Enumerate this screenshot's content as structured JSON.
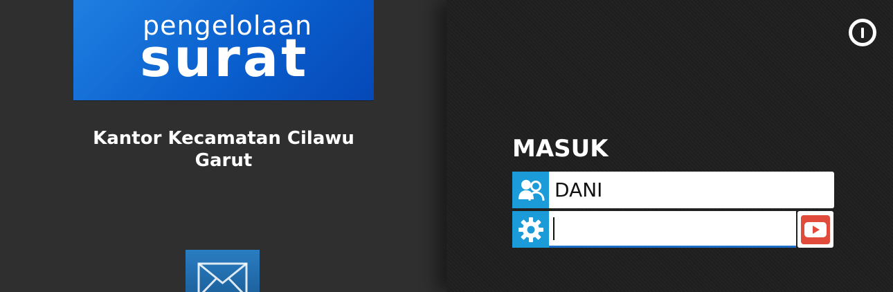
{
  "logo": {
    "line1": "pengelolaan",
    "line2": "surat"
  },
  "office": {
    "name_line1": "Kantor Kecamatan Cilawu",
    "name_line2": "Garut"
  },
  "login": {
    "title": "MASUK",
    "username_value": "DANI",
    "password_value": ""
  },
  "icons": {
    "power": "power-icon",
    "users": "users-icon",
    "gear": "gear-icon",
    "submit": "play-icon",
    "mail": "mail-icon"
  },
  "colors": {
    "accent_blue": "#1b9bd7",
    "logo_blue": "#0a5fce",
    "submit_red": "#e04b3c",
    "background_left": "#2f2f2f",
    "background_right": "#1f1f1f"
  }
}
